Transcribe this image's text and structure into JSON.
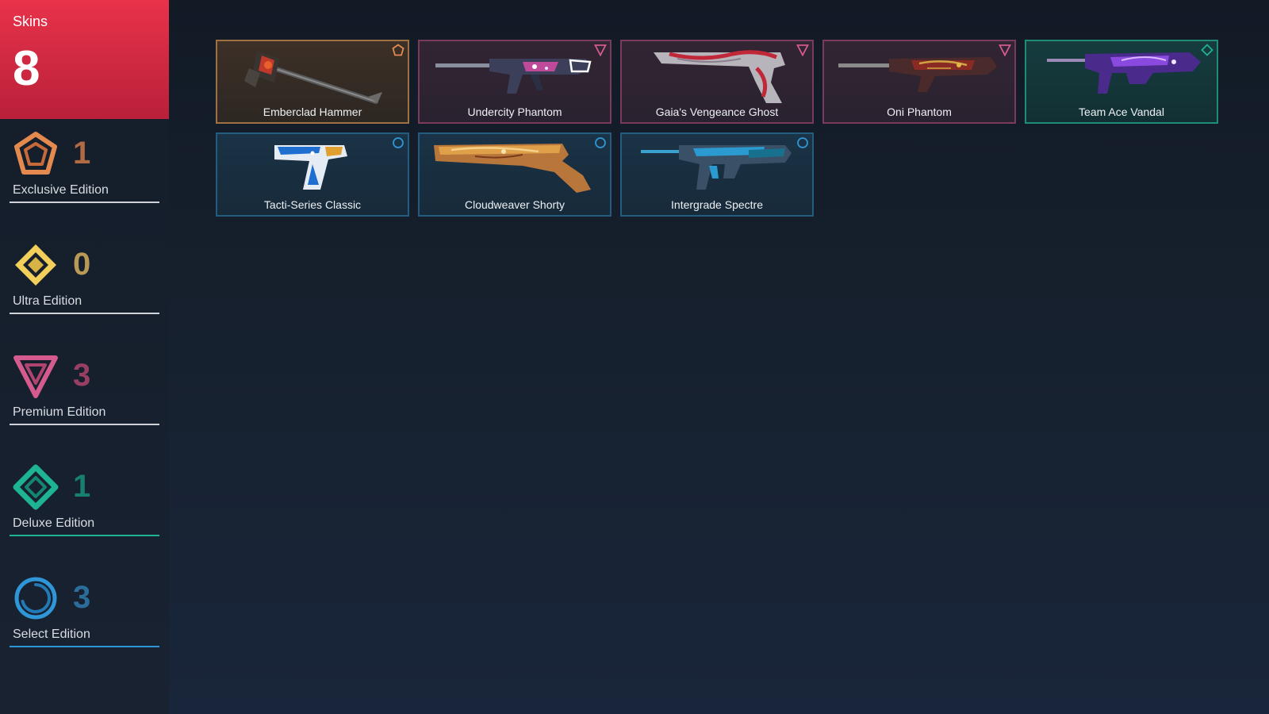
{
  "skins": {
    "label": "Skins",
    "count": "8"
  },
  "tiers": [
    {
      "id": "exclusive",
      "name": "Exclusive Edition",
      "count": "1",
      "color": "#e58a4e",
      "count_color": "#b06a44",
      "icon": "exclusive-edition-icon"
    },
    {
      "id": "ultra",
      "name": "Ultra Edition",
      "count": "0",
      "color": "#f1cf5a",
      "count_color": "#b89a56",
      "icon": "ultra-edition-icon"
    },
    {
      "id": "premium",
      "name": "Premium Edition",
      "count": "3",
      "color": "#d55a8e",
      "count_color": "#9a3f64",
      "icon": "premium-edition-icon"
    },
    {
      "id": "deluxe",
      "name": "Deluxe Edition",
      "count": "1",
      "color": "#1db393",
      "count_color": "#177f6c",
      "icon": "deluxe-edition-icon"
    },
    {
      "id": "select",
      "name": "Select Edition",
      "count": "3",
      "color": "#2f96d8",
      "count_color": "#2a6d9a",
      "icon": "select-edition-icon"
    }
  ],
  "cards": [
    {
      "name": "Emberclad Hammer",
      "tier": "exclusive"
    },
    {
      "name": "Undercity Phantom",
      "tier": "premium"
    },
    {
      "name": "Gaia's Vengeance Ghost",
      "tier": "premium"
    },
    {
      "name": "Oni Phantom",
      "tier": "premium"
    },
    {
      "name": "Team Ace Vandal",
      "tier": "deluxe"
    },
    {
      "name": "Tacti-Series Classic",
      "tier": "select"
    },
    {
      "name": "Cloudweaver Shorty",
      "tier": "select"
    },
    {
      "name": "Intergrade Spectre",
      "tier": "select"
    }
  ]
}
